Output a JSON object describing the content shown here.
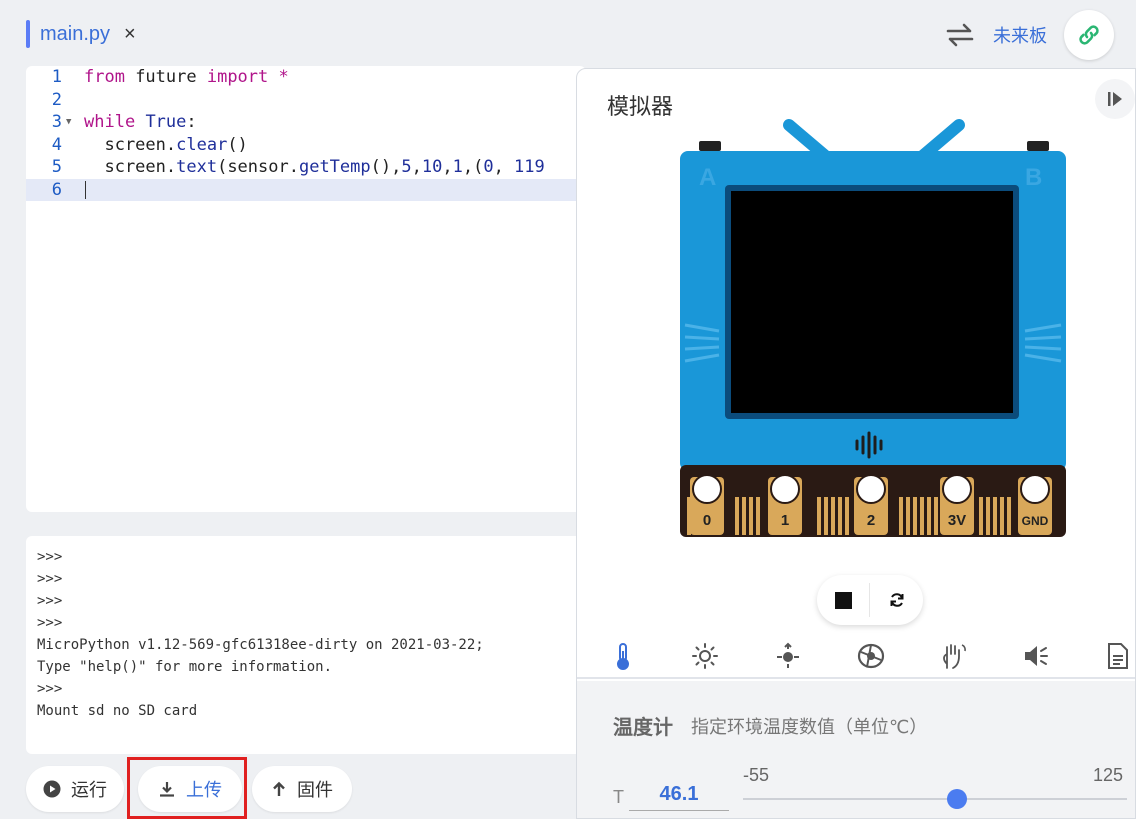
{
  "tab": {
    "filename": "main.py",
    "close_glyph": "×"
  },
  "header": {
    "board_name": "未来板"
  },
  "editor": {
    "lines": [
      {
        "n": "1",
        "tokens": [
          [
            "kw",
            "from"
          ],
          [
            "t",
            " future "
          ],
          [
            "kw",
            "import"
          ],
          [
            "kw",
            " *"
          ]
        ]
      },
      {
        "n": "2",
        "tokens": []
      },
      {
        "n": "3",
        "tokens": [
          [
            "kw",
            "while"
          ],
          [
            "t",
            " "
          ],
          [
            "kw2",
            "True"
          ],
          [
            "t",
            ":"
          ]
        ]
      },
      {
        "n": "4",
        "tokens": [
          [
            "t",
            "  screen."
          ],
          [
            "fn",
            "clear"
          ],
          [
            "t",
            "()"
          ]
        ]
      },
      {
        "n": "5",
        "tokens": [
          [
            "t",
            "  screen."
          ],
          [
            "fn",
            "text"
          ],
          [
            "t",
            "(sensor."
          ],
          [
            "fn",
            "getTemp"
          ],
          [
            "t",
            "(),"
          ],
          [
            "num",
            "5"
          ],
          [
            "t",
            ","
          ],
          [
            "num",
            "10"
          ],
          [
            "t",
            ","
          ],
          [
            "num",
            "1"
          ],
          [
            "t",
            ",("
          ],
          [
            "num",
            "0"
          ],
          [
            "t",
            ", "
          ],
          [
            "num",
            "119"
          ]
        ]
      },
      {
        "n": "6",
        "tokens": []
      }
    ],
    "active_line": 6
  },
  "console": {
    "lines": [
      ">>>",
      ">>>",
      ">>>",
      ">>>",
      "MicroPython v1.12-569-gfc61318ee-dirty on 2021-03-22;",
      "Type \"help()\" for more information.",
      ">>>",
      "Mount sd no SD card"
    ]
  },
  "buttons": {
    "run": "运行",
    "upload": "上传",
    "firmware": "固件"
  },
  "simulator": {
    "title": "模拟器",
    "board_button_a": "A",
    "board_button_b": "B",
    "pins": [
      "0",
      "1",
      "2",
      "3V",
      "GND"
    ],
    "sensor_tabs": [
      "thermometer-icon",
      "light-sun-icon",
      "joystick-icon",
      "compass-icon",
      "gesture-hand-icon",
      "speaker-icon",
      "file-icon"
    ],
    "sensor": {
      "name": "温度计",
      "description": "指定环境温度数值（单位℃）",
      "field_label": "T",
      "value": "46.1",
      "min": "-55",
      "max": "125"
    }
  },
  "colors": {
    "accent": "#3a6fd8",
    "board_blue": "#1a97d8",
    "pin_gold": "#d9a85a",
    "highlight_red": "#e02020"
  }
}
